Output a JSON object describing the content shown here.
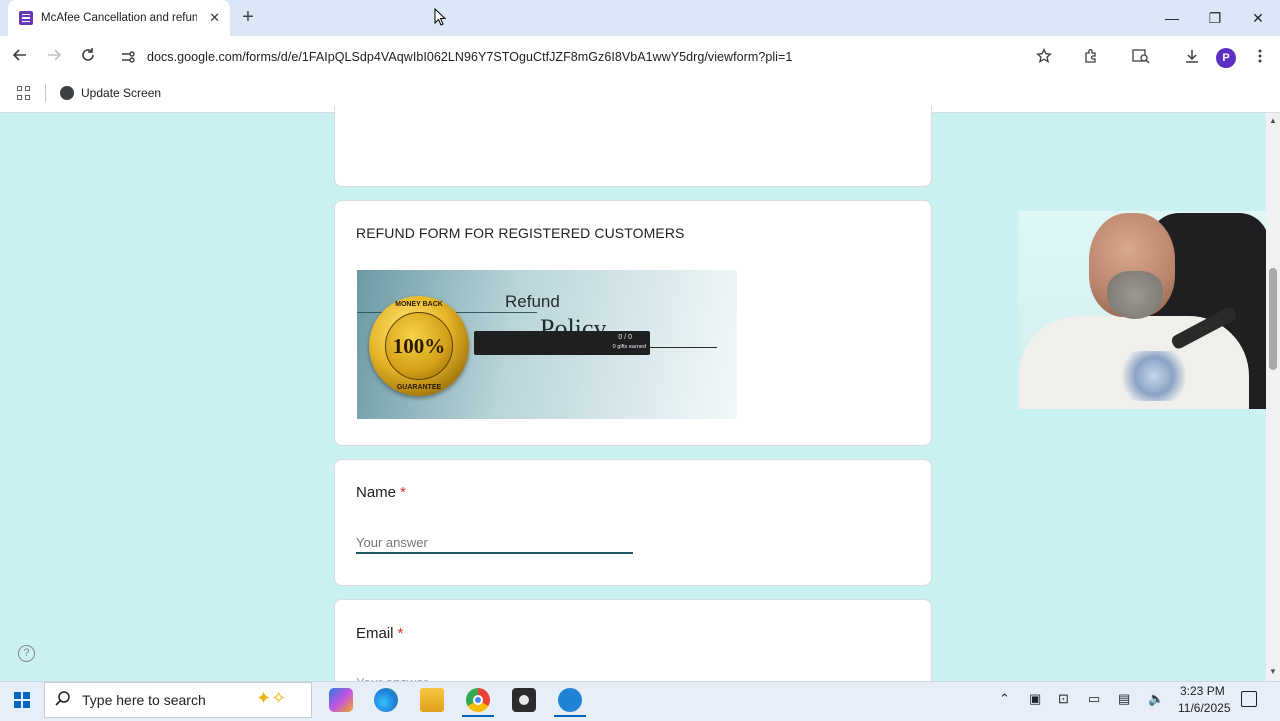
{
  "browser": {
    "tab_title": "McAfee Cancellation and refund",
    "tab_close": "✕",
    "new_tab": "+",
    "window_controls": {
      "minimize": "—",
      "maximize": "❐",
      "close": "✕"
    },
    "url": "docs.google.com/forms/d/e/1FAIpQLSdp4VAqwIbI062LN96Y7STOguCtfJZF8mGz6I8VbA1wwY5drg/viewform?pli=1",
    "profile_initial": "P",
    "bookmark": "Update Screen",
    "icons": [
      "back-icon",
      "forward-icon",
      "reload-icon",
      "site-info-icon",
      "star-icon",
      "extensions-icon",
      "tab-search-icon",
      "download-icon",
      "menu-icon"
    ]
  },
  "form": {
    "section_title": "REFUND FORM FOR REGISTERED CUSTOMERS",
    "banner": {
      "heading": "Refund",
      "subheading": "Policy",
      "seal_top": "MONEY BACK",
      "seal_center": "100%",
      "seal_bottom": "GUARANTEE",
      "overlay_count": "0 / 0",
      "overlay_gifts": "0 gifts earned"
    },
    "questions": [
      {
        "label": "Name",
        "required_mark": "*",
        "placeholder": "Your answer"
      },
      {
        "label": "Email",
        "required_mark": "*",
        "placeholder": "Your answer"
      }
    ],
    "help": "?"
  },
  "taskbar": {
    "search_placeholder": "Type here to search",
    "apps": [
      "copilot",
      "edge",
      "file-explorer",
      "chrome",
      "camera",
      "app"
    ],
    "time": "3:23 PM",
    "date": "11/6/2025"
  },
  "colors": {
    "page_background": "#cbf2f3",
    "accent": "#1e5a66",
    "required": "#d93025",
    "form_purple": "#673ab7"
  }
}
